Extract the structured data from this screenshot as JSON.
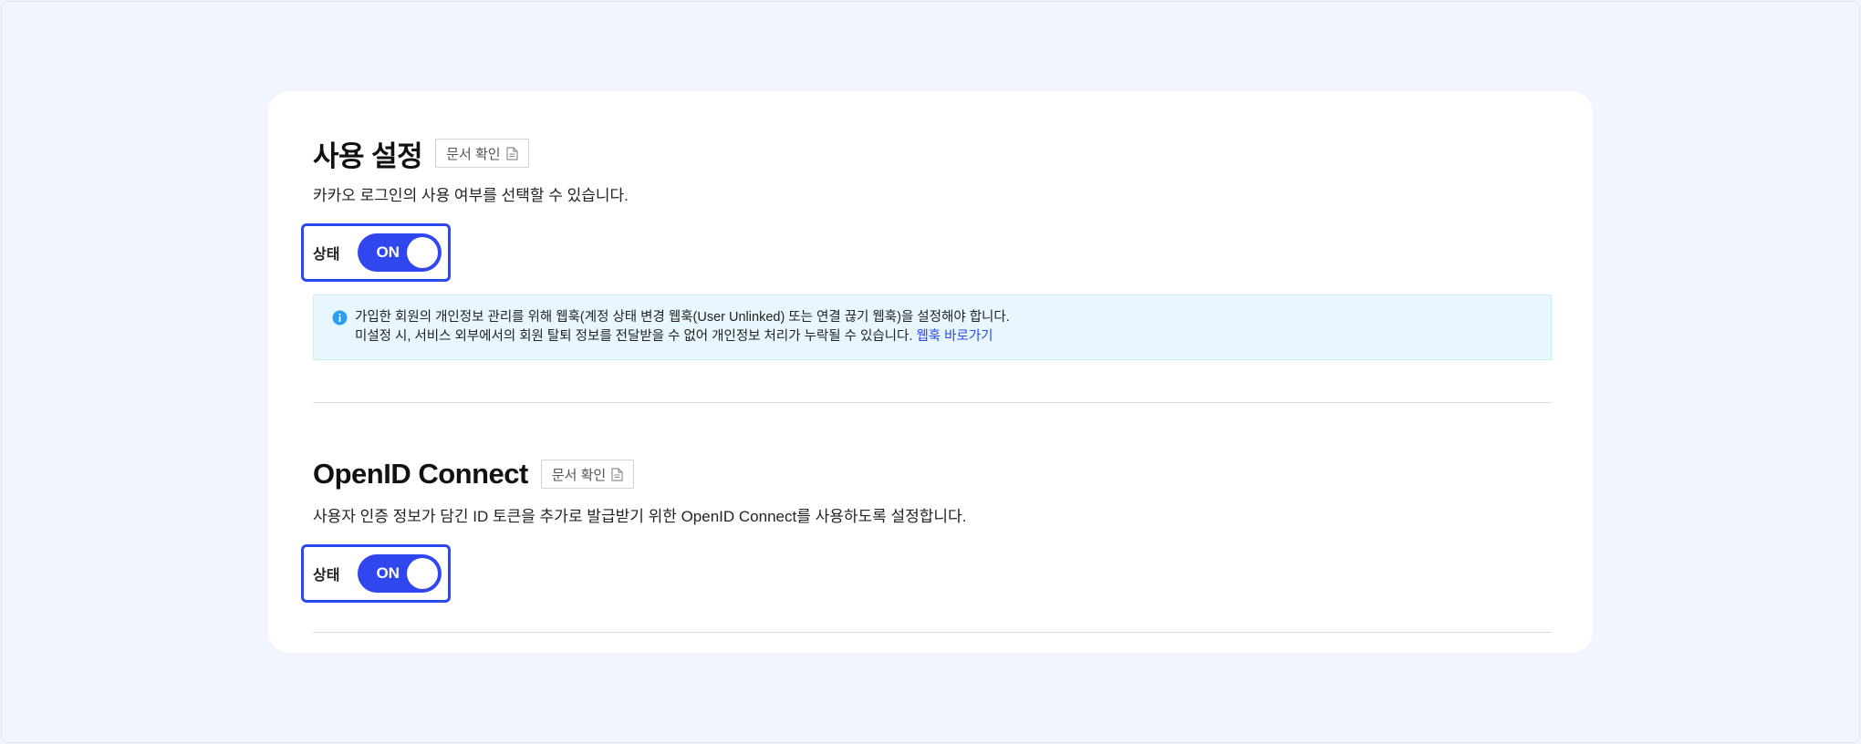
{
  "sections": [
    {
      "title": "사용 설정",
      "doc_button_label": "문서 확인",
      "description": "카카오 로그인의 사용 여부를 선택할 수 있습니다.",
      "status_label": "상태",
      "toggle_state": "ON",
      "notice": {
        "line1": "가입한 회원의 개인정보 관리를 위해 웹훅(계정 상태 변경 웹훅(User Unlinked) 또는 연결 끊기 웹훅)을 설정해야 합니다.",
        "line2": "미설정 시, 서비스 외부에서의 회원 탈퇴 정보를 전달받을 수 없어 개인정보 처리가 누락될 수 있습니다.",
        "link": "웹훅 바로가기"
      }
    },
    {
      "title": "OpenID Connect",
      "doc_button_label": "문서 확인",
      "description": "사용자 인증 정보가 담긴 ID 토큰을 추가로 발급받기 위한 OpenID Connect를 사용하도록 설정합니다.",
      "status_label": "상태",
      "toggle_state": "ON"
    }
  ],
  "colors": {
    "accent": "#2a48f0",
    "toggle_on": "#3047f0",
    "notice_bg": "#e8f7fd",
    "info_icon": "#2b9ff0",
    "page_bg": "#f1f5fd"
  },
  "icons": {
    "doc": "document-icon",
    "info": "info-icon"
  }
}
